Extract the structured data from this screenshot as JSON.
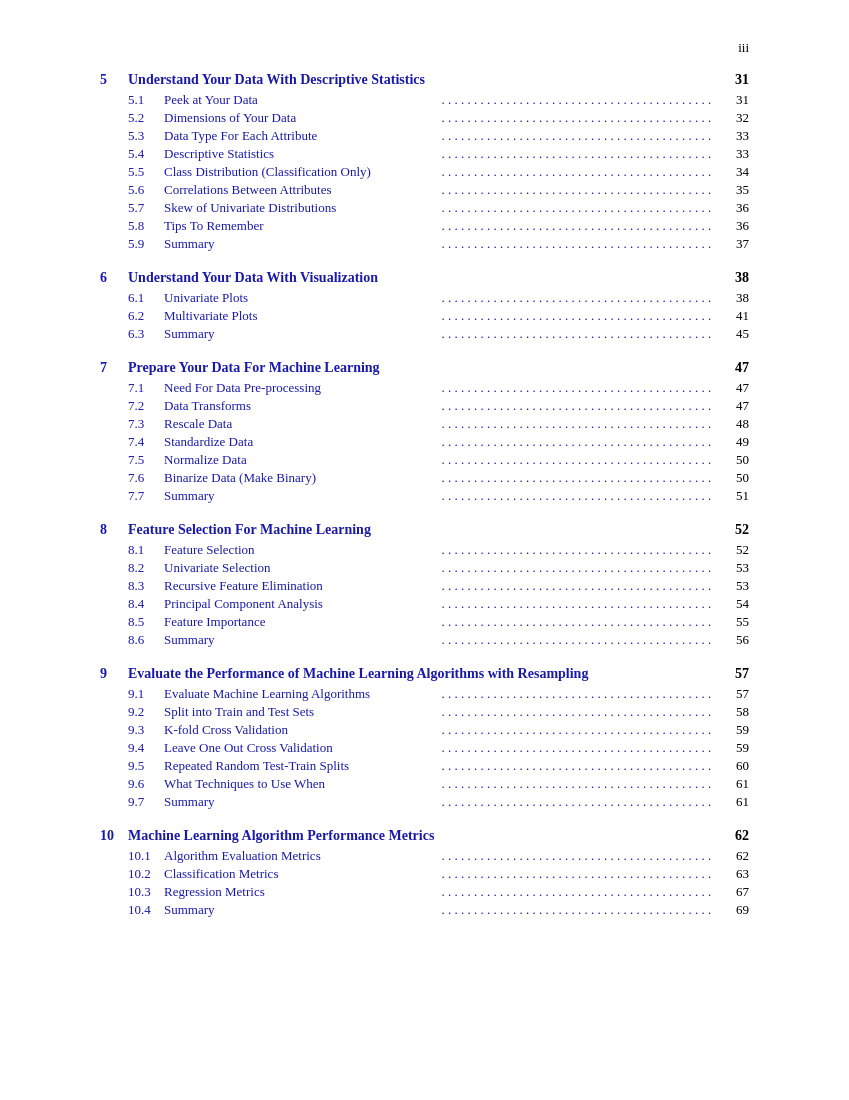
{
  "page": {
    "page_number": "iii",
    "chapters": [
      {
        "num": "5",
        "title": "Understand Your Data With Descriptive Statistics",
        "page": "31",
        "sections": [
          {
            "num": "5.1",
            "title": "Peek at Your Data",
            "page": "31"
          },
          {
            "num": "5.2",
            "title": "Dimensions of Your Data",
            "page": "32"
          },
          {
            "num": "5.3",
            "title": "Data Type For Each Attribute",
            "page": "33"
          },
          {
            "num": "5.4",
            "title": "Descriptive Statistics",
            "page": "33"
          },
          {
            "num": "5.5",
            "title": "Class Distribution (Classification Only)",
            "page": "34"
          },
          {
            "num": "5.6",
            "title": "Correlations Between Attributes",
            "page": "35"
          },
          {
            "num": "5.7",
            "title": "Skew of Univariate Distributions",
            "page": "36"
          },
          {
            "num": "5.8",
            "title": "Tips To Remember",
            "page": "36"
          },
          {
            "num": "5.9",
            "title": "Summary",
            "page": "37"
          }
        ]
      },
      {
        "num": "6",
        "title": "Understand Your Data With Visualization",
        "page": "38",
        "sections": [
          {
            "num": "6.1",
            "title": "Univariate Plots",
            "page": "38"
          },
          {
            "num": "6.2",
            "title": "Multivariate Plots",
            "page": "41"
          },
          {
            "num": "6.3",
            "title": "Summary",
            "page": "45"
          }
        ]
      },
      {
        "num": "7",
        "title": "Prepare Your Data For Machine Learning",
        "page": "47",
        "sections": [
          {
            "num": "7.1",
            "title": "Need For Data Pre-processing",
            "page": "47"
          },
          {
            "num": "7.2",
            "title": "Data Transforms",
            "page": "47"
          },
          {
            "num": "7.3",
            "title": "Rescale Data",
            "page": "48"
          },
          {
            "num": "7.4",
            "title": "Standardize Data",
            "page": "49"
          },
          {
            "num": "7.5",
            "title": "Normalize Data",
            "page": "50"
          },
          {
            "num": "7.6",
            "title": "Binarize Data (Make Binary)",
            "page": "50"
          },
          {
            "num": "7.7",
            "title": "Summary",
            "page": "51"
          }
        ]
      },
      {
        "num": "8",
        "title": "Feature Selection For Machine Learning",
        "page": "52",
        "sections": [
          {
            "num": "8.1",
            "title": "Feature Selection",
            "page": "52"
          },
          {
            "num": "8.2",
            "title": "Univariate Selection",
            "page": "53"
          },
          {
            "num": "8.3",
            "title": "Recursive Feature Elimination",
            "page": "53"
          },
          {
            "num": "8.4",
            "title": "Principal Component Analysis",
            "page": "54"
          },
          {
            "num": "8.5",
            "title": "Feature Importance",
            "page": "55"
          },
          {
            "num": "8.6",
            "title": "Summary",
            "page": "56"
          }
        ]
      },
      {
        "num": "9",
        "title": "Evaluate the Performance of Machine Learning Algorithms with Resampling",
        "page": "57",
        "sections": [
          {
            "num": "9.1",
            "title": "Evaluate Machine Learning Algorithms",
            "page": "57"
          },
          {
            "num": "9.2",
            "title": "Split into Train and Test Sets",
            "page": "58"
          },
          {
            "num": "9.3",
            "title": "K-fold Cross Validation",
            "page": "59"
          },
          {
            "num": "9.4",
            "title": "Leave One Out Cross Validation",
            "page": "59"
          },
          {
            "num": "9.5",
            "title": "Repeated Random Test-Train Splits",
            "page": "60"
          },
          {
            "num": "9.6",
            "title": "What Techniques to Use When",
            "page": "61"
          },
          {
            "num": "9.7",
            "title": "Summary",
            "page": "61"
          }
        ]
      },
      {
        "num": "10",
        "title": "Machine Learning Algorithm Performance Metrics",
        "page": "62",
        "sections": [
          {
            "num": "10.1",
            "title": "Algorithm Evaluation Metrics",
            "page": "62"
          },
          {
            "num": "10.2",
            "title": "Classification Metrics",
            "page": "63"
          },
          {
            "num": "10.3",
            "title": "Regression Metrics",
            "page": "67"
          },
          {
            "num": "10.4",
            "title": "Summary",
            "page": "69"
          }
        ]
      }
    ]
  }
}
